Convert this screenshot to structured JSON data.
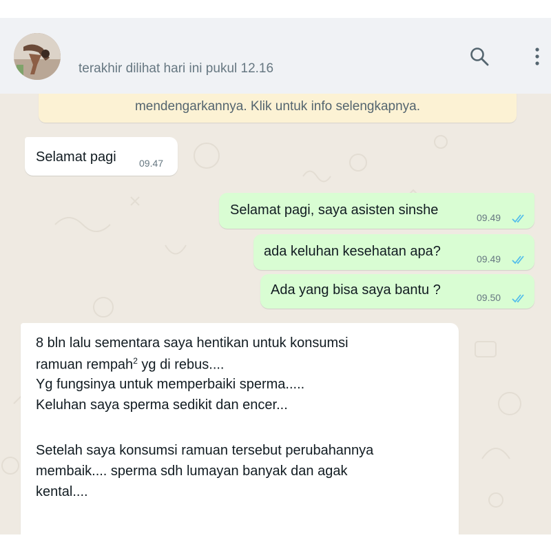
{
  "header": {
    "last_seen": "terakhir dilihat hari ini pukul 12.16",
    "icons": {
      "search": "search-icon",
      "menu": "more-vertical-icon"
    }
  },
  "banner": {
    "text": "mendengarkannya. Klik untuk info selengkapnya."
  },
  "messages": [
    {
      "direction": "incoming",
      "text": "Selamat pagi",
      "time": "09.47"
    },
    {
      "direction": "outgoing",
      "text": "Selamat pagi, saya asisten sinshe",
      "time": "09.49",
      "status": "read"
    },
    {
      "direction": "outgoing",
      "text": "ada keluhan kesehatan apa?",
      "time": "09.49",
      "status": "read"
    },
    {
      "direction": "outgoing",
      "text": "Ada yang bisa saya bantu ?",
      "time": "09.50",
      "status": "read"
    },
    {
      "direction": "incoming",
      "lines": [
        "8 bln lalu sementara saya hentikan untuk konsumsi",
        "ramuan rempah",
        "2",
        " yg di rebus....",
        "Yg fungsinya untuk memperbaiki sperma.....",
        "Keluhan saya sperma sedikit dan encer...",
        "Setelah saya konsumsi ramuan tersebut perubahannya",
        "membaik.... sperma sdh lumayan banyak dan agak",
        "kental...."
      ]
    }
  ],
  "colors": {
    "chat_bg": "#efeae2",
    "incoming_bubble": "#ffffff",
    "outgoing_bubble": "#d9fdd3",
    "read_ticks": "#53bdeb",
    "banner_bg": "#fcf2d4",
    "header_bg": "#f0f2f5"
  }
}
